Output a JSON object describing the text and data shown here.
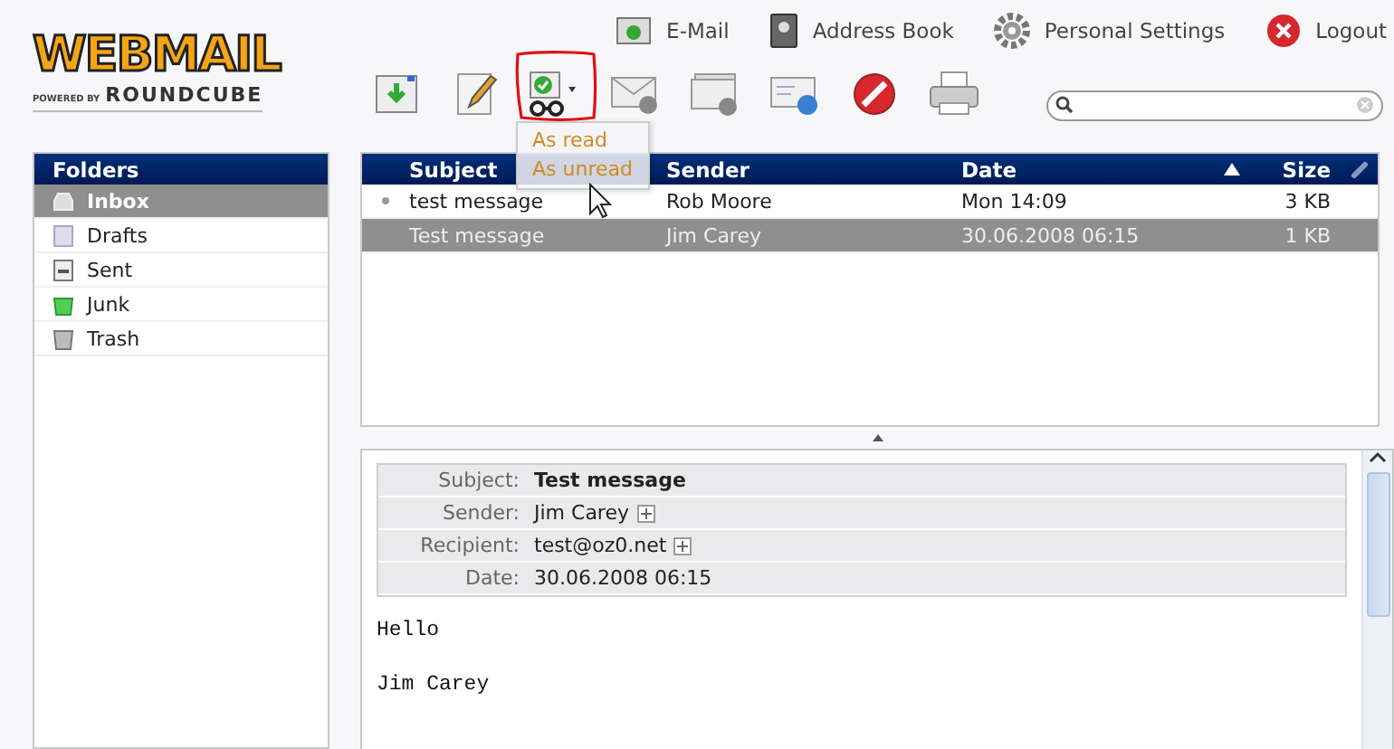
{
  "logo": {
    "title": "WEBMAIL",
    "powered": "POWERED BY",
    "brand": "ROUNDCUBE"
  },
  "nav": [
    {
      "label": "E-Mail",
      "kind": "mail"
    },
    {
      "label": "Address Book",
      "kind": "contacts"
    },
    {
      "label": "Personal Settings",
      "kind": "settings"
    },
    {
      "label": "Logout",
      "kind": "logout"
    }
  ],
  "toolbar": [
    {
      "kind": "check-mail"
    },
    {
      "kind": "compose"
    },
    {
      "kind": "mark",
      "highlighted": true
    },
    {
      "kind": "reply"
    },
    {
      "kind": "reply-all"
    },
    {
      "kind": "forward"
    },
    {
      "kind": "delete"
    },
    {
      "kind": "print"
    }
  ],
  "mark_menu": [
    "As read",
    "As unread"
  ],
  "folders": {
    "title": "Folders",
    "items": [
      {
        "label": "Inbox",
        "kind": "inbox",
        "selected": true
      },
      {
        "label": "Drafts",
        "kind": "drafts",
        "selected": false
      },
      {
        "label": "Sent",
        "kind": "sent",
        "selected": false
      },
      {
        "label": "Junk",
        "kind": "junk",
        "selected": false
      },
      {
        "label": "Trash",
        "kind": "trash",
        "selected": false
      }
    ]
  },
  "table": {
    "columns": [
      {
        "label": "Subject",
        "sorted": false
      },
      {
        "label": "Sender",
        "sorted": false
      },
      {
        "label": "Date",
        "sorted": true
      },
      {
        "label": "Size",
        "sorted": false
      }
    ],
    "rows": [
      {
        "subject": "test message",
        "sender": "Rob Moore",
        "date": "Mon 14:09",
        "size": "3 KB",
        "selected": false,
        "marked": true
      },
      {
        "subject": "Test message",
        "sender": "Jim Carey",
        "date": "30.06.2008 06:15",
        "size": "1 KB",
        "selected": true,
        "marked": false
      }
    ]
  },
  "preview": {
    "headers": [
      {
        "label": "Subject:",
        "value": "Test message",
        "kind": "subject",
        "expandable": false
      },
      {
        "label": "Sender:",
        "value": "Jim Carey",
        "kind": "plain",
        "expandable": true
      },
      {
        "label": "Recipient:",
        "value": "test@oz0.net",
        "kind": "plain",
        "expandable": true
      },
      {
        "label": "Date:",
        "value": "30.06.2008 06:15",
        "kind": "plain",
        "expandable": false
      }
    ],
    "body": [
      "Hello",
      "Jim Carey"
    ]
  }
}
